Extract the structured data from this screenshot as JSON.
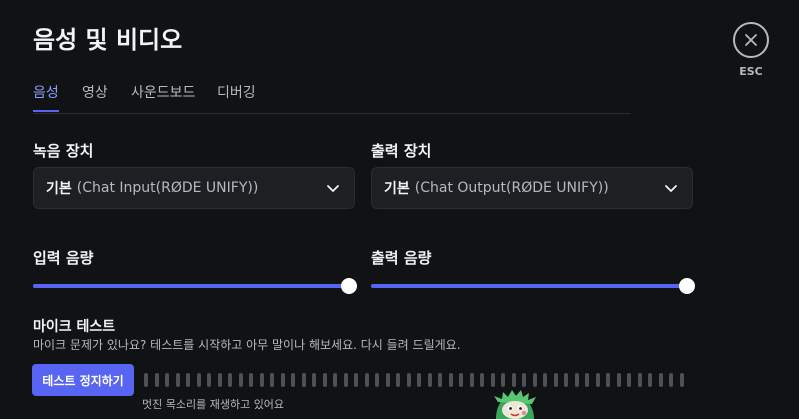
{
  "header": {
    "title": "음성 및 비디오",
    "close_label": "ESC"
  },
  "tabs": [
    {
      "label": "음성",
      "active": true
    },
    {
      "label": "영상",
      "active": false
    },
    {
      "label": "사운드보드",
      "active": false
    },
    {
      "label": "디버깅",
      "active": false
    }
  ],
  "input_device": {
    "label": "녹음 장치",
    "value_main": "기본",
    "value_sub": "(Chat Input(RØDE UNIFY))"
  },
  "output_device": {
    "label": "출력 장치",
    "value_main": "기본",
    "value_sub": "(Chat Output(RØDE UNIFY))"
  },
  "input_volume": {
    "label": "입력 음량",
    "percent": 100
  },
  "output_volume": {
    "label": "출력 음량",
    "percent": 100
  },
  "mic_test": {
    "title": "마이크 테스트",
    "description": "마이크 문제가 있나요? 테스트를 시작하고 아무 말이나 해보세요. 다시 들려 드릴게요.",
    "button_label": "테스트 정지하기",
    "caption": "멋진 목소리를 재생하고 있어요",
    "level_percent": 0
  },
  "icons": {
    "close": "close-icon",
    "chevron": "chevron-down-icon",
    "mascot": "mascot-illustration"
  },
  "colors": {
    "accent": "#5865f2",
    "active_tab": "#949cf7",
    "background": "#111214",
    "input_bg": "#1e1f22"
  }
}
